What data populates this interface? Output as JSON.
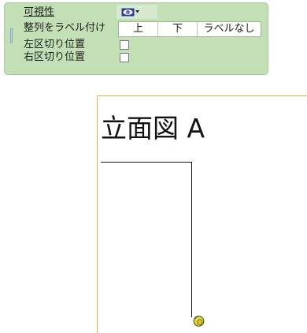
{
  "palette": {
    "visibility": {
      "label": "可視性",
      "icon": "eye-icon",
      "dropdown_icon": "chevron-down-icon"
    },
    "alignment": {
      "label": "整列をラベル付け",
      "options": [
        "上",
        "下",
        "ラベルなし"
      ]
    },
    "left_break": {
      "label": "左区切り位置",
      "checked": false
    },
    "right_break": {
      "label": "右区切り位置",
      "checked": false
    }
  },
  "drawing": {
    "view_title": "立面図 A",
    "handle_icon": "drag-handle-icon"
  },
  "colors": {
    "palette_background": "#c3dfb5",
    "sheet_border": "#e2b04a",
    "handle_fill": "#f2d23a",
    "eye_icon": "#2a3aa8"
  }
}
